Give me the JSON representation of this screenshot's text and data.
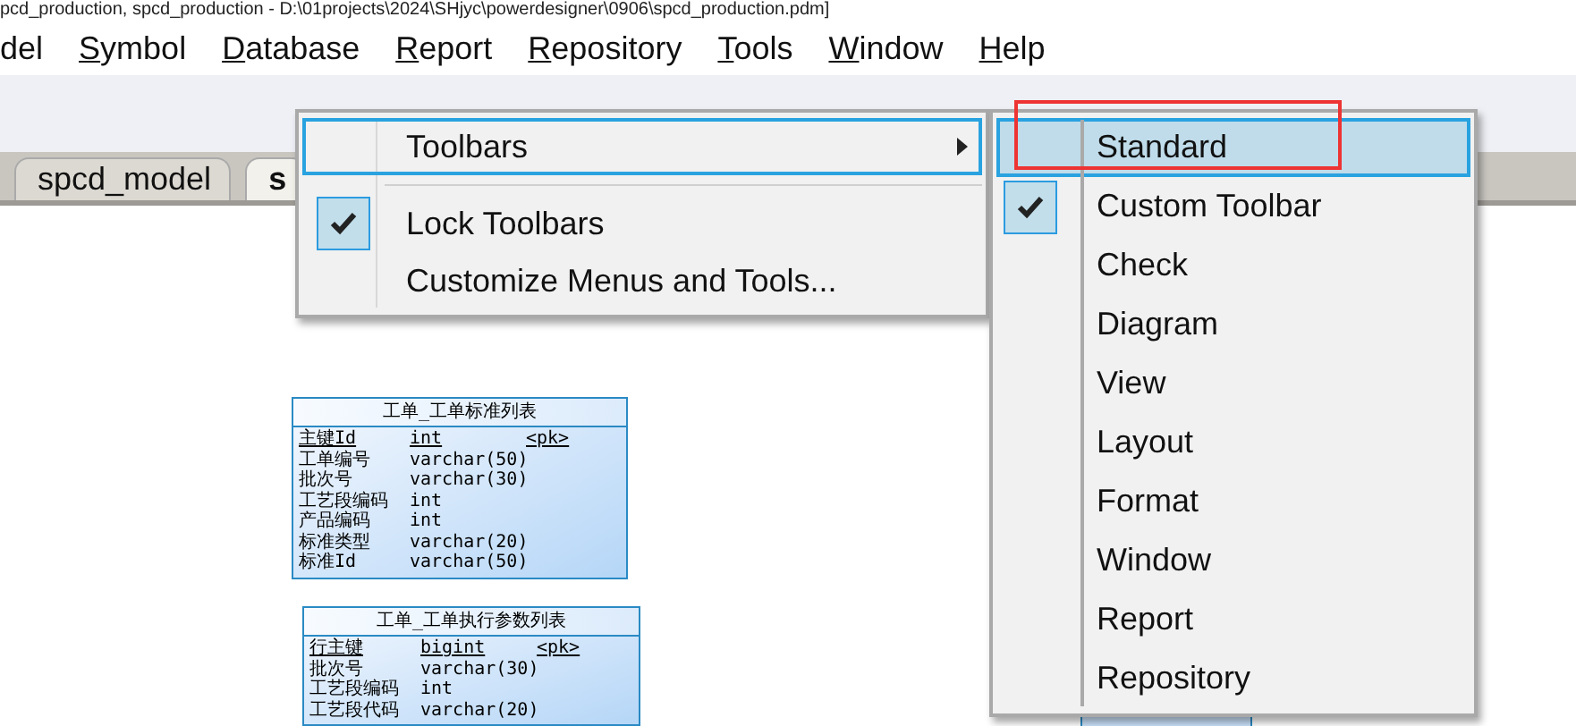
{
  "title_bar": {
    "text": "pcd_production, spcd_production - D:\\01projects\\2024\\SHjyc\\powerdesigner\\0906\\spcd_production.pdm]"
  },
  "menu_bar": [
    {
      "label": "del",
      "underline_first": false
    },
    {
      "label": "Symbol",
      "underline_first": true
    },
    {
      "label": "Database",
      "underline_first": true
    },
    {
      "label": "Report",
      "underline_first": true
    },
    {
      "label": "Repository",
      "underline_first": true
    },
    {
      "label": "Tools",
      "underline_first": true
    },
    {
      "label": "Window",
      "underline_first": true
    },
    {
      "label": "Help",
      "underline_first": true
    }
  ],
  "tabs": [
    {
      "label": "spcd_model",
      "selected": false
    },
    {
      "label": "s",
      "selected": true
    }
  ],
  "tables": [
    {
      "title": "工单_工单标准列表",
      "rows": [
        {
          "name": "主键Id",
          "type": "int",
          "key": "<pk>"
        },
        {
          "name": "工单编号",
          "type": "varchar(50)"
        },
        {
          "name": "批次号",
          "type": "varchar(30)"
        },
        {
          "name": "工艺段编码",
          "type": "int"
        },
        {
          "name": "产品编码",
          "type": "int"
        },
        {
          "name": "标准类型",
          "type": "varchar(20)"
        },
        {
          "name": "标准Id",
          "type": "varchar(50)"
        }
      ]
    },
    {
      "title": "工单_工单执行参数列表",
      "rows": [
        {
          "name": "行主键",
          "type": "bigint",
          "key": "<pk>"
        },
        {
          "name": "批次号",
          "type": "varchar(30)"
        },
        {
          "name": "工艺段编码",
          "type": "int"
        },
        {
          "name": "工艺段代码",
          "type": "varchar(20)"
        }
      ]
    }
  ],
  "context_menu": {
    "items": [
      {
        "kind": "submenu",
        "label": "Toolbars",
        "selected": true,
        "checked": false
      },
      {
        "kind": "separator"
      },
      {
        "kind": "item",
        "label": "Lock Toolbars",
        "selected": false,
        "checked": true
      },
      {
        "kind": "item",
        "label": "Customize Menus and Tools...",
        "selected": false,
        "checked": false
      }
    ]
  },
  "toolbars_submenu": {
    "items": [
      {
        "label": "Standard",
        "selected": true,
        "checked": false
      },
      {
        "label": "Custom Toolbar",
        "selected": false,
        "checked": true
      },
      {
        "label": "Check",
        "selected": false,
        "checked": false
      },
      {
        "label": "Diagram",
        "selected": false,
        "checked": false
      },
      {
        "label": "View",
        "selected": false,
        "checked": false
      },
      {
        "label": "Layout",
        "selected": false,
        "checked": false
      },
      {
        "label": "Format",
        "selected": false,
        "checked": false
      },
      {
        "label": "Window",
        "selected": false,
        "checked": false
      },
      {
        "label": "Report",
        "selected": false,
        "checked": false
      },
      {
        "label": "Repository",
        "selected": false,
        "checked": false
      }
    ]
  }
}
